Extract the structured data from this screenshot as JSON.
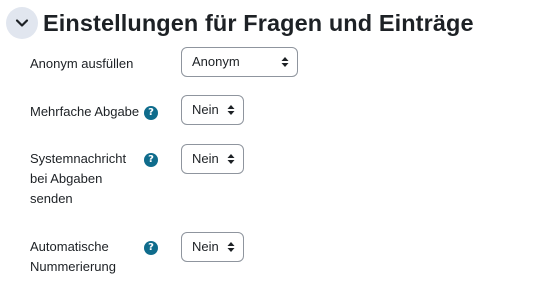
{
  "section": {
    "title": "Einstellungen für Fragen und Einträge",
    "toggle_icon": "chevron-down-icon"
  },
  "fields": {
    "anonym": {
      "label": "Anonym ausfüllen",
      "value": "Anonym"
    },
    "mehrfache": {
      "label": "Mehrfache Abgabe",
      "help_icon": "question-help-icon",
      "value": "Nein"
    },
    "systemnachricht": {
      "label_lines": [
        "Systemnachricht",
        "bei Abgaben",
        "senden"
      ],
      "help_icon": "question-help-icon",
      "value": "Nein"
    },
    "nummerierung": {
      "label_lines": [
        "Automatische",
        "Nummerierung"
      ],
      "help_icon": "question-help-icon",
      "value": "Nein"
    }
  },
  "colors": {
    "toggle_background": "#e1e6ef",
    "help_icon": "#0f6c8c",
    "text": "#1d2125",
    "select_border": "#8f959e"
  }
}
